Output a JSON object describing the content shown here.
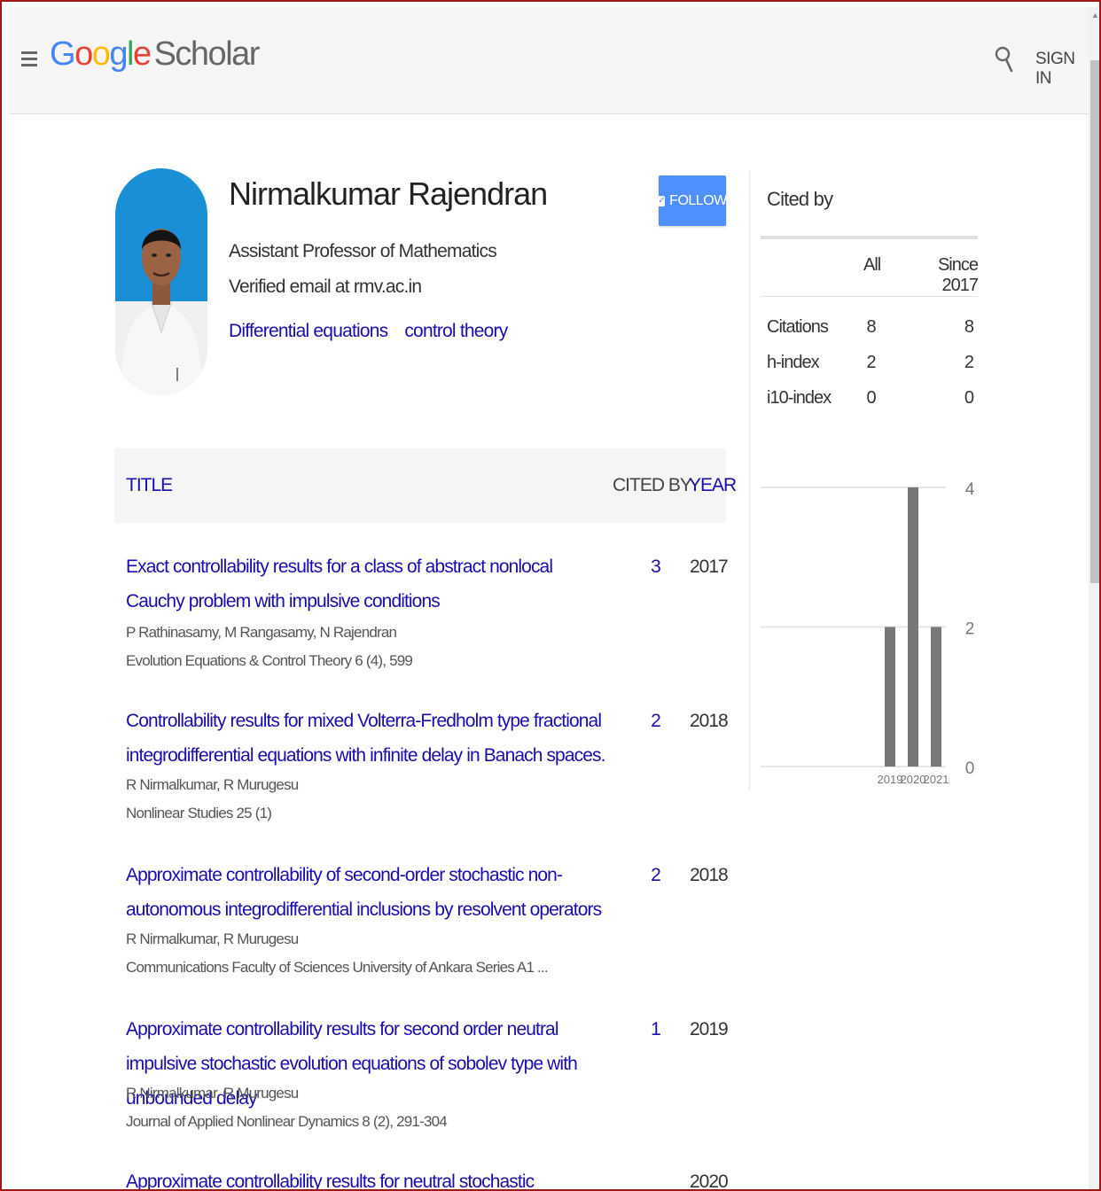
{
  "header": {
    "logo_letters": [
      "G",
      "o",
      "o",
      "g",
      "l",
      "e"
    ],
    "logo_scholar": "Scholar",
    "sign_in": "SIGN IN"
  },
  "profile": {
    "name": "Nirmalkumar Rajendran",
    "affiliation": "Assistant Professor of Mathematics",
    "email": "Verified email at rmv.ac.in",
    "interests": [
      "Differential equations",
      "control theory"
    ],
    "follow_label": "FOLLOW"
  },
  "table": {
    "headers": {
      "title": "TITLE",
      "cited_by": "CITED BY",
      "year": "YEAR"
    },
    "rows": [
      {
        "title": "Exact controllability results for a class of abstract nonlocal Cauchy problem with impulsive conditions",
        "authors": "P Rathinasamy, M Rangasamy, N Rajendran",
        "venue": "Evolution Equations & Control Theory 6 (4), 599",
        "cited_by": "3",
        "year": "2017"
      },
      {
        "title": "Controllability results for mixed Volterra-Fredholm type fractional integrodifferential equations with infinite delay in Banach spaces.",
        "authors": "R Nirmalkumar, R Murugesu",
        "venue": "Nonlinear Studies 25 (1)",
        "cited_by": "2",
        "year": "2018"
      },
      {
        "title": "Approximate controllability of second-order stochastic non-autonomous integrodifferential inclusions by resolvent operators",
        "authors": "R Nirmalkumar, R Murugesu",
        "venue": "Communications Faculty of Sciences University of Ankara Series A1 ...",
        "cited_by": "2",
        "year": "2018"
      },
      {
        "title": "Approximate controllability results for second order neutral impulsive stochastic evolution equations of sobolev type with unbounded delay",
        "authors": "R Nirmalkumar, R Murugesu",
        "venue": "Journal of Applied Nonlinear Dynamics 8 (2), 291-304",
        "cited_by": "1",
        "year": "2019"
      },
      {
        "title": "Approximate controllability results for neutral stochastic integrodifferential equations of",
        "authors": "",
        "venue": "",
        "cited_by": "",
        "year": "2020"
      }
    ]
  },
  "cited_by": {
    "title": "Cited by",
    "col_all": "All",
    "col_since": "Since 2017",
    "rows": [
      {
        "label": "Citations",
        "all": "8",
        "since": "8"
      },
      {
        "label": "h-index",
        "all": "2",
        "since": "2"
      },
      {
        "label": "i10-index",
        "all": "0",
        "since": "0"
      }
    ]
  },
  "chart_data": {
    "type": "bar",
    "categories": [
      "2019",
      "2020",
      "2021"
    ],
    "values": [
      2,
      4,
      2
    ],
    "y_ticks": [
      "0",
      "2",
      "4"
    ],
    "ylim": [
      0,
      4
    ],
    "bar_color": "#777777",
    "grid": true
  }
}
